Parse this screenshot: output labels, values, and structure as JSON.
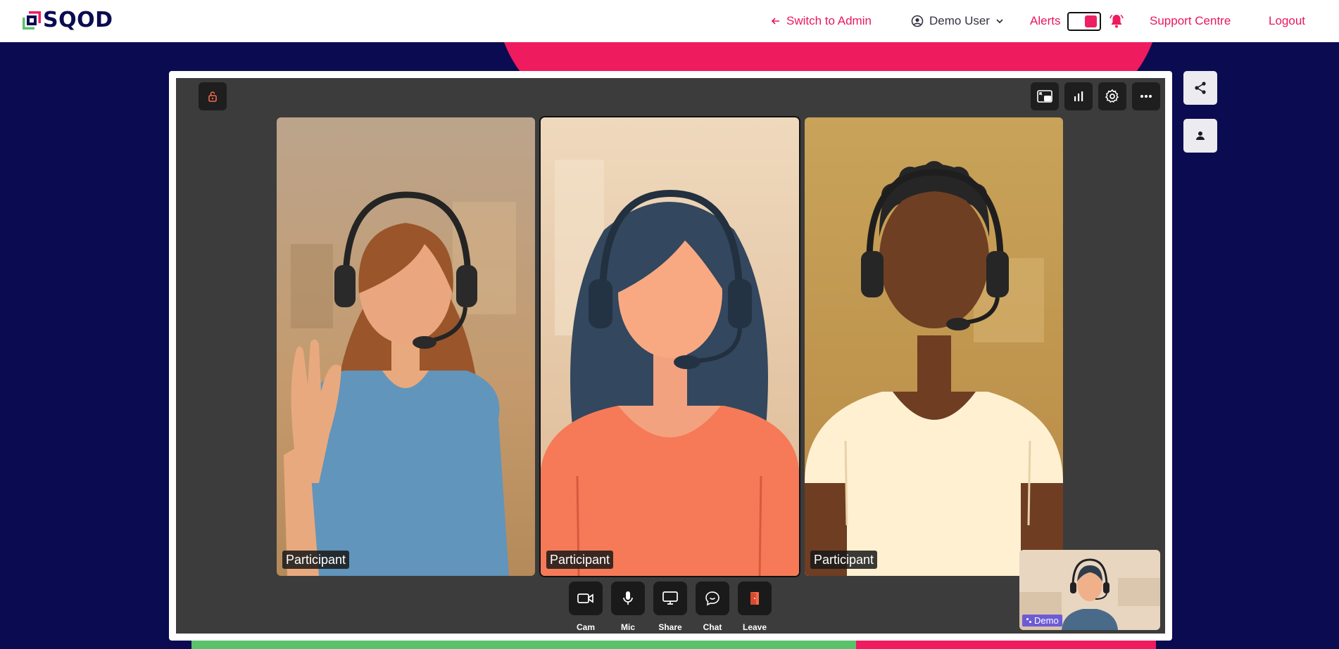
{
  "brand": {
    "logo_text": "SQOD",
    "colors": {
      "pink": "#ee1b5f",
      "navy": "#0b0b52",
      "green": "#5bc26c"
    }
  },
  "nav": {
    "switch_admin": "Switch to Admin",
    "user_name": "Demo User",
    "alerts_label": "Alerts",
    "alerts_toggle_on": true,
    "support": "Support Centre",
    "logout": "Logout"
  },
  "meeting": {
    "top_left_icon": "lock-open-icon",
    "top_right_icons": [
      "picture-in-picture-icon",
      "bar-chart-icon",
      "settings-gear-icon",
      "more-horizontal-icon"
    ],
    "participants": [
      {
        "label": "Participant"
      },
      {
        "label": "Participant"
      },
      {
        "label": "Participant"
      }
    ],
    "controls": [
      {
        "label": "Cam",
        "icon": "camera-icon"
      },
      {
        "label": "Mic",
        "icon": "microphone-icon"
      },
      {
        "label": "Share",
        "icon": "screen-share-icon"
      },
      {
        "label": "Chat",
        "icon": "chat-icon"
      },
      {
        "label": "Leave",
        "icon": "leave-door-icon"
      }
    ],
    "self_view_label": "Demo"
  },
  "side_actions": [
    "share-icon",
    "person-icon"
  ]
}
